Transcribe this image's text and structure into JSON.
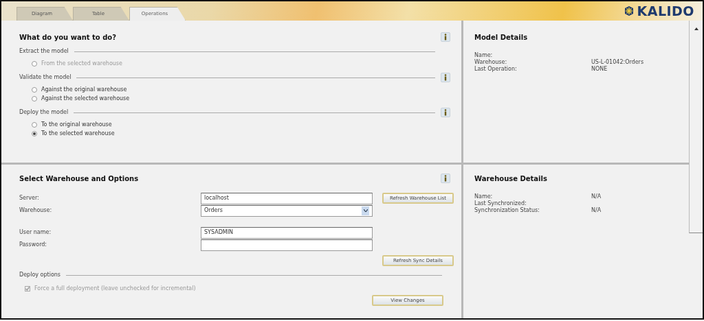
{
  "tabs": [
    {
      "label": "Diagram",
      "selected": false
    },
    {
      "label": "Table",
      "selected": false
    },
    {
      "label": "Operations",
      "selected": true
    }
  ],
  "logo": {
    "text": "KALIDO"
  },
  "operations": {
    "title": "What do you want to do?",
    "groups": [
      {
        "label": "Extract the model",
        "options": [
          {
            "label": "From the selected warehouse",
            "selected": false,
            "disabled": true
          }
        ]
      },
      {
        "label": "Validate the model",
        "options": [
          {
            "label": "Against the original warehouse",
            "selected": false,
            "disabled": false
          },
          {
            "label": "Against the selected warehouse",
            "selected": false,
            "disabled": false
          }
        ]
      },
      {
        "label": "Deploy the model",
        "options": [
          {
            "label": "To the original warehouse",
            "selected": false,
            "disabled": false
          },
          {
            "label": "To the selected warehouse",
            "selected": true,
            "disabled": false
          }
        ]
      }
    ]
  },
  "warehouse_options": {
    "title": "Select Warehouse and Options",
    "fields": [
      {
        "label": "Server:",
        "kind": "text",
        "value": "localhost"
      },
      {
        "label": "Warehouse:",
        "kind": "select",
        "value": "Orders"
      },
      {
        "label": "User name:",
        "kind": "text",
        "value": "SYSADMIN"
      },
      {
        "label": "Password:",
        "kind": "password"
      }
    ],
    "buttons": [
      {
        "label": "Refresh Warehouse List"
      },
      {
        "label": "Refresh Sync Details"
      },
      {
        "label": "View Changes"
      }
    ],
    "deploy_options": {
      "label": "Deploy options",
      "checkbox": {
        "label": "Force a full deployment (leave unchecked for incremental)",
        "checked": true,
        "disabled": true
      }
    }
  },
  "model_details": {
    "title": "Model Details",
    "rows": [
      {
        "label": "Name:"
      },
      {
        "label": "Warehouse:",
        "value": "US-L-01042:Orders"
      },
      {
        "label": "Last Operation:",
        "value": "NONE"
      }
    ]
  },
  "warehouse_details": {
    "title": "Warehouse Details",
    "rows": [
      {
        "label": "Name:",
        "value": "N/A"
      },
      {
        "label": "Last Synchronized:"
      },
      {
        "label": "Synchronization Status:",
        "value": "N/A"
      }
    ]
  }
}
